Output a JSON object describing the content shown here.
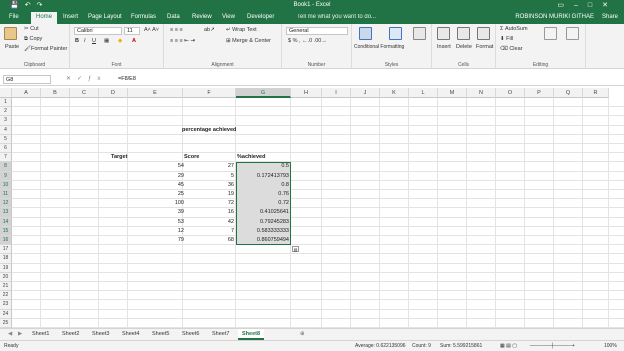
{
  "titlebar": {
    "title": "Book1 - Excel"
  },
  "tabs": [
    "File",
    "Home",
    "Insert",
    "Page Layout",
    "Formulas",
    "Data",
    "Review",
    "View",
    "Developer"
  ],
  "tell_me": "Tell me what you want to do...",
  "user": "ROBINSON MURIKI GITHAE",
  "share": "Share",
  "ribbon": {
    "clipboard": {
      "paste": "Paste",
      "cut": "Cut",
      "copy": "Copy",
      "format_painter": "Format Painter",
      "label": "Clipboard"
    },
    "font": {
      "name": "Calibri",
      "size": "11",
      "label": "Font"
    },
    "alignment": {
      "wrap": "Wrap Text",
      "merge": "Merge & Center",
      "label": "Alignment"
    },
    "number": {
      "format": "General",
      "label": "Number"
    },
    "styles": {
      "cond": "Conditional Formatting",
      "format_table": "Format as Table",
      "cell_styles": "Cell Styles",
      "label": "Styles"
    },
    "cells": {
      "insert": "Insert",
      "delete": "Delete",
      "format": "Format",
      "label": "Cells"
    },
    "editing": {
      "autosum": "AutoSum",
      "fill": "Fill",
      "clear": "Clear",
      "sort": "Sort & Filter",
      "find": "Find & Select",
      "label": "Editing"
    }
  },
  "formula_bar": {
    "name_box": "G8",
    "formula": "=F8/E8"
  },
  "columns": [
    "A",
    "B",
    "C",
    "D",
    "E",
    "F",
    "G",
    "H",
    "I",
    "J",
    "K",
    "L",
    "M",
    "N",
    "O",
    "P",
    "Q",
    "R"
  ],
  "rows": [
    "1",
    "2",
    "3",
    "4",
    "5",
    "6",
    "7",
    "8",
    "9",
    "10",
    "11",
    "12",
    "13",
    "14",
    "15",
    "16",
    "17",
    "18",
    "19",
    "20",
    "21",
    "22",
    "23",
    "24",
    "25"
  ],
  "sheet": {
    "heading": "percentage achieved",
    "col_target": "Target",
    "col_score": "Score",
    "col_achieved": "%achieved",
    "data": [
      {
        "target": "54",
        "score": "27",
        "pct": "0.5"
      },
      {
        "target": "29",
        "score": "5",
        "pct": "0.172413793"
      },
      {
        "target": "45",
        "score": "36",
        "pct": "0.8"
      },
      {
        "target": "25",
        "score": "19",
        "pct": "0.76"
      },
      {
        "target": "100",
        "score": "72",
        "pct": "0.72"
      },
      {
        "target": "39",
        "score": "16",
        "pct": "0.41025641"
      },
      {
        "target": "53",
        "score": "42",
        "pct": "0.79245283"
      },
      {
        "target": "12",
        "score": "7",
        "pct": "0.583333333"
      },
      {
        "target": "79",
        "score": "68",
        "pct": "0.860759494"
      }
    ]
  },
  "sheet_tabs": [
    "Sheet1",
    "Sheet2",
    "Sheet3",
    "Sheet4",
    "Sheet5",
    "Sheet6",
    "Sheet7",
    "Sheet8"
  ],
  "active_sheet": "Sheet8",
  "status": {
    "ready": "Ready",
    "average": "Average: 0.622135096",
    "count": "Count: 9",
    "sum": "Sum: 5.599215861",
    "zoom": "100%"
  }
}
